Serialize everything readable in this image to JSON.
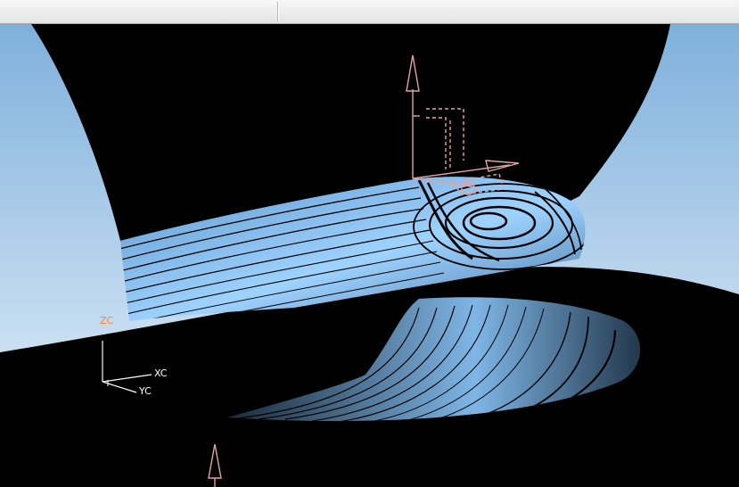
{
  "window": {
    "toolbar_present": true
  },
  "viewport": {
    "background_top": "#7fb0dc",
    "background_bottom": "#eaf3fb",
    "surface_color": "#86c4f5",
    "surface_dark": "#1b2b3a",
    "wcs_color": "#e2a3a3",
    "triad_axis_color": "#ffffff",
    "triad": {
      "zc": "ZC",
      "xc": "XC",
      "yc": "YC",
      "zc_color": "#ff7f27"
    }
  }
}
